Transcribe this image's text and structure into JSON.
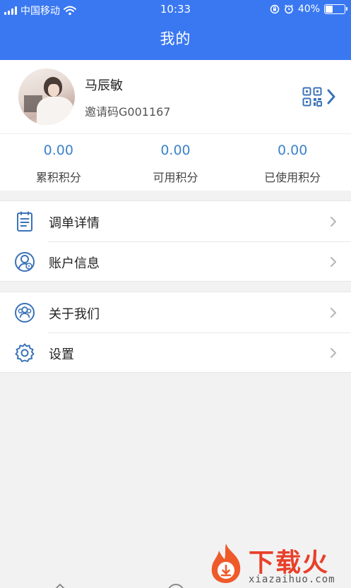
{
  "status_bar": {
    "carrier": "中国移动",
    "time": "10:33",
    "battery": "40%",
    "battery_level": 0.4
  },
  "nav": {
    "title": "我的"
  },
  "profile": {
    "name": "马辰敏",
    "invite_code": "邀请码G001167",
    "qr_icon": "qr-code-icon",
    "chevron_icon": "chevron-right-icon"
  },
  "points": [
    {
      "value": "0.00",
      "label": "累积积分"
    },
    {
      "value": "0.00",
      "label": "可用积分"
    },
    {
      "value": "0.00",
      "label": "已使用积分"
    }
  ],
  "menu": {
    "group1": [
      {
        "label": "调单详情",
        "icon": "document-icon"
      },
      {
        "label": "账户信息",
        "icon": "account-info-icon"
      }
    ],
    "group2": [
      {
        "label": "关于我们",
        "icon": "people-icon"
      },
      {
        "label": "设置",
        "icon": "settings-icon"
      }
    ]
  },
  "colors": {
    "primary": "#3a78f2",
    "points_value": "#3d83c9",
    "icon_blue": "#3b73b8",
    "background": "#f2f2f2"
  },
  "watermark": {
    "brand": "下载火",
    "url": "xiazaihuo.com"
  }
}
